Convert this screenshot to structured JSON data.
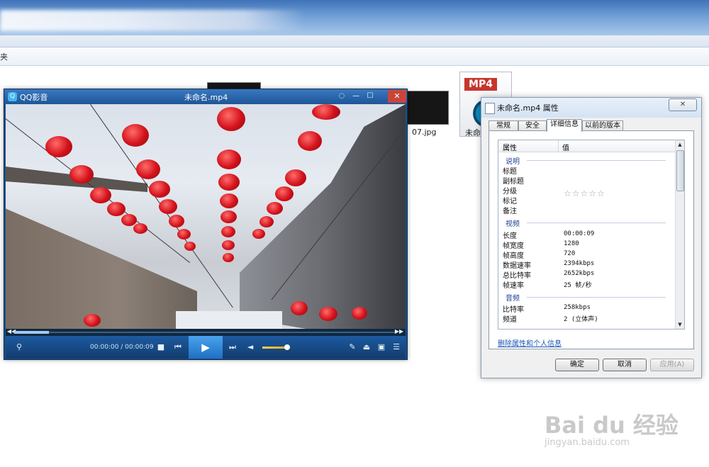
{
  "explorer": {
    "toolbar_fragment": "夹",
    "thumb_label": "07.jpg",
    "file_icon_badge": "MP4",
    "file_icon_label": "未命"
  },
  "player": {
    "app_name": "QQ影音",
    "file_name": "未命名.mp4",
    "time_display": "00:00:00 / 00:00:09",
    "seek_progress": 0.09,
    "volume_level": 0.85
  },
  "dialog": {
    "title": "未命名.mp4 属性",
    "tabs": [
      "常规",
      "安全",
      "详细信息",
      "以前的版本"
    ],
    "active_tab": "详细信息",
    "header": {
      "property": "属性",
      "value": "值"
    },
    "groups": {
      "description": "说明",
      "video": "视频",
      "audio": "音频"
    },
    "description_rows": [
      "标题",
      "副标题",
      "分级",
      "标记",
      "备注"
    ],
    "rating_stars": 0,
    "video_rows": [
      {
        "k": "长度",
        "v": "00:00:09"
      },
      {
        "k": "帧宽度",
        "v": "1280"
      },
      {
        "k": "帧高度",
        "v": "720"
      },
      {
        "k": "数据速率",
        "v": "2394kbps"
      },
      {
        "k": "总比特率",
        "v": "2652kbps"
      },
      {
        "k": "帧速率",
        "v": "25 帧/秒"
      }
    ],
    "audio_rows": [
      {
        "k": "比特率",
        "v": "258kbps"
      },
      {
        "k": "频道",
        "v": "2 (立体声)"
      }
    ],
    "remove_link": "删除属性和个人信息",
    "buttons": {
      "ok": "确定",
      "cancel": "取消",
      "apply": "应用(A)"
    }
  },
  "watermark": {
    "main": "Bai du 经验",
    "sub": "jingyan.baidu.com"
  }
}
